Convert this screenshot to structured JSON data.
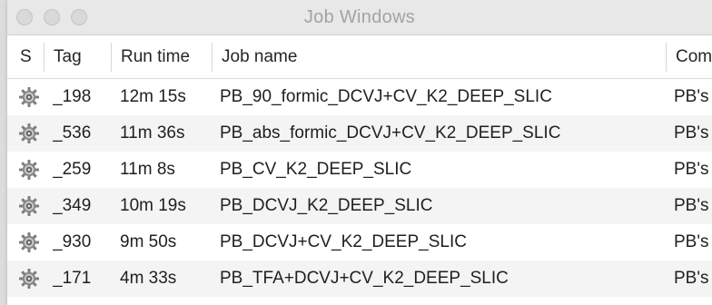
{
  "window": {
    "title": "Job Windows"
  },
  "columns": [
    {
      "key": "status",
      "label": "S"
    },
    {
      "key": "tag",
      "label": "Tag"
    },
    {
      "key": "run_time",
      "label": "Run time"
    },
    {
      "key": "job_name",
      "label": "Job name"
    },
    {
      "key": "comment",
      "label": "Com"
    }
  ],
  "rows": [
    {
      "status_icon": "gear-icon",
      "tag": "_198",
      "run_time": "12m 15s",
      "job_name": "PB_90_formic_DCVJ+CV_K2_DEEP_SLIC",
      "comment": "PB's"
    },
    {
      "status_icon": "gear-icon",
      "tag": "_536",
      "run_time": "11m 36s",
      "job_name": "PB_abs_formic_DCVJ+CV_K2_DEEP_SLIC",
      "comment": "PB's"
    },
    {
      "status_icon": "gear-icon",
      "tag": "_259",
      "run_time": "11m 8s",
      "job_name": "PB_CV_K2_DEEP_SLIC",
      "comment": "PB's"
    },
    {
      "status_icon": "gear-icon",
      "tag": "_349",
      "run_time": "10m 19s",
      "job_name": "PB_DCVJ_K2_DEEP_SLIC",
      "comment": "PB's"
    },
    {
      "status_icon": "gear-icon",
      "tag": "_930",
      "run_time": "9m 50s",
      "job_name": "PB_DCVJ+CV_K2_DEEP_SLIC",
      "comment": "PB's"
    },
    {
      "status_icon": "gear-icon",
      "tag": "_171",
      "run_time": "4m 33s",
      "job_name": "PB_TFA+DCVJ+CV_K2_DEEP_SLIC",
      "comment": "PB's"
    }
  ]
}
